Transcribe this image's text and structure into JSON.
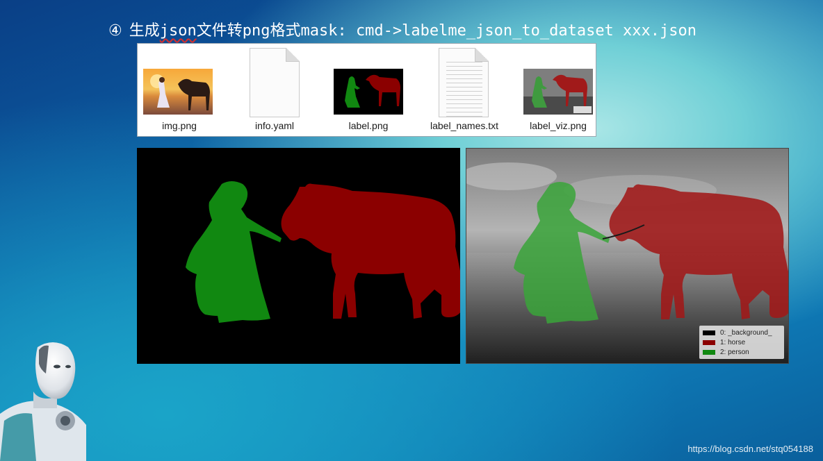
{
  "slide": {
    "title_number": "④",
    "title_prefix": "生成",
    "title_json": "json",
    "title_rest": "文件转png格式mask: cmd->labelme_json_to_dataset xxx.json"
  },
  "explorer": {
    "files": [
      {
        "name": "img.png",
        "icon": "photo-thumbnail"
      },
      {
        "name": "info.yaml",
        "icon": "blank-document-icon"
      },
      {
        "name": "label.png",
        "icon": "mask-thumbnail"
      },
      {
        "name": "label_names.txt",
        "icon": "text-document-icon"
      },
      {
        "name": "label_viz.png",
        "icon": "viz-thumbnail"
      }
    ]
  },
  "legend": {
    "items": [
      {
        "label": "0: _background_",
        "color": "#000000"
      },
      {
        "label": "1: horse",
        "color": "#8b0000"
      },
      {
        "label": "2: person",
        "color": "#118811"
      }
    ]
  },
  "colors": {
    "person": "#118811",
    "horse": "#8b0000",
    "background": "#000000"
  },
  "watermark": "https://blog.csdn.net/stq054188"
}
